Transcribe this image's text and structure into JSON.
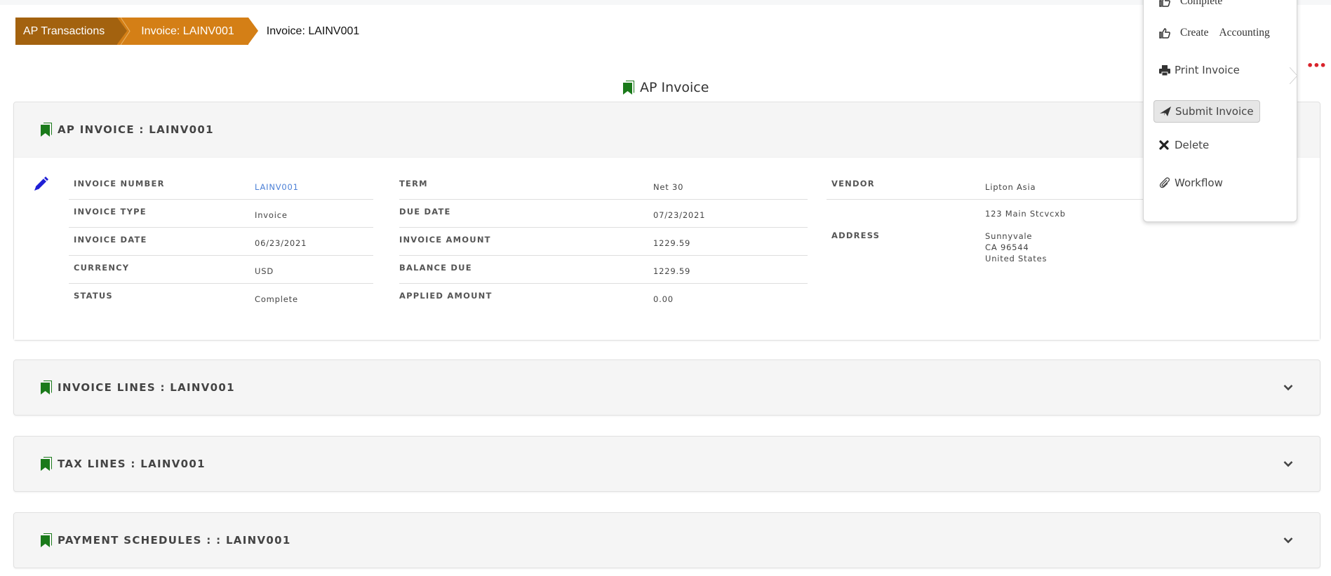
{
  "breadcrumb": {
    "items": [
      "AP Transactions",
      "Invoice: LAINV001"
    ],
    "current": "Invoice: LAINV001"
  },
  "colors": {
    "crumb_dark": "#a3620f",
    "crumb_light": "#d47f16",
    "icon_green": "#1a7a1a",
    "link_blue": "#4a7fd6",
    "more_red": "#d9232b",
    "edit_blue": "#1f1fd6"
  },
  "page": {
    "title": "AP Invoice",
    "more_label": "•••"
  },
  "header_card": {
    "title": "AP INVOICE : LAINV001",
    "col1": [
      {
        "label": "INVOICE NUMBER",
        "value": "LAINV001"
      },
      {
        "label": "INVOICE TYPE",
        "value": "Invoice"
      },
      {
        "label": "INVOICE DATE",
        "value": "06/23/2021"
      },
      {
        "label": "CURRENCY",
        "value": "USD"
      },
      {
        "label": "STATUS",
        "value": "Complete"
      }
    ],
    "col2": [
      {
        "label": "TERM",
        "value": "Net 30"
      },
      {
        "label": "DUE DATE",
        "value": "07/23/2021"
      },
      {
        "label": "INVOICE AMOUNT",
        "value": "1229.59"
      },
      {
        "label": "BALANCE DUE",
        "value": "1229.59"
      },
      {
        "label": "APPLIED AMOUNT",
        "value": "0.00"
      }
    ],
    "vendor": {
      "label": "VENDOR",
      "value": "Lipton Asia"
    },
    "address": {
      "label": "ADDRESS",
      "line1": "123 Main Stcvcxb",
      "line2": "Sunnyvale",
      "line3": "CA 96544",
      "line4": "United States"
    }
  },
  "sections": [
    {
      "title": "INVOICE LINES : LAINV001"
    },
    {
      "title": "TAX LINES : LAINV001"
    },
    {
      "title": "PAYMENT SCHEDULES : : LAINV001"
    }
  ],
  "menu": {
    "complete": "Complete",
    "create_accounting": "Create Accounting",
    "print_invoice": "Print Invoice",
    "submit_invoice": "Submit Invoice",
    "delete": "Delete",
    "workflow": "Workflow"
  }
}
